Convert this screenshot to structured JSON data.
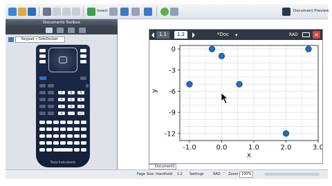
{
  "toolbar": {
    "insert_label": "Insert",
    "document_preview_label": "Document Preview"
  },
  "toolbox": {
    "title": "Documents Toolbox",
    "keypad_select_value": "Keypad • SideDocker",
    "brand": "Texas Instruments"
  },
  "document": {
    "tabs": [
      "1.1",
      "1.2"
    ],
    "active_tab": "1.2",
    "name": "*Doc",
    "angle_mode": "RAD"
  },
  "chart_data": {
    "type": "scatter",
    "xlabel": "x",
    "ylabel": "y",
    "xlim": [
      -1.3,
      3.0
    ],
    "ylim": [
      -13,
      0.5
    ],
    "x_ticks": [
      "-1.0",
      "0.0",
      "1.0",
      "2.0",
      "3.0"
    ],
    "y_ticks": [
      "0",
      "-3",
      "-6",
      "-9",
      "-12"
    ],
    "grid": true,
    "points": [
      {
        "x": -1.0,
        "y": -5
      },
      {
        "x": -0.3,
        "y": 0
      },
      {
        "x": 0.0,
        "y": -1
      },
      {
        "x": 0.55,
        "y": -5
      },
      {
        "x": 2.0,
        "y": -12
      },
      {
        "x": 2.7,
        "y": 0
      }
    ],
    "point_color": "#1f6fc5"
  },
  "statusbar": {
    "doc_tab": "Document1",
    "page_size": "Page Size: Handheld",
    "page": "1.2",
    "settings": "Settings",
    "mode": "RAD",
    "zoom_label": "Zoom:",
    "zoom_value": "100%"
  }
}
